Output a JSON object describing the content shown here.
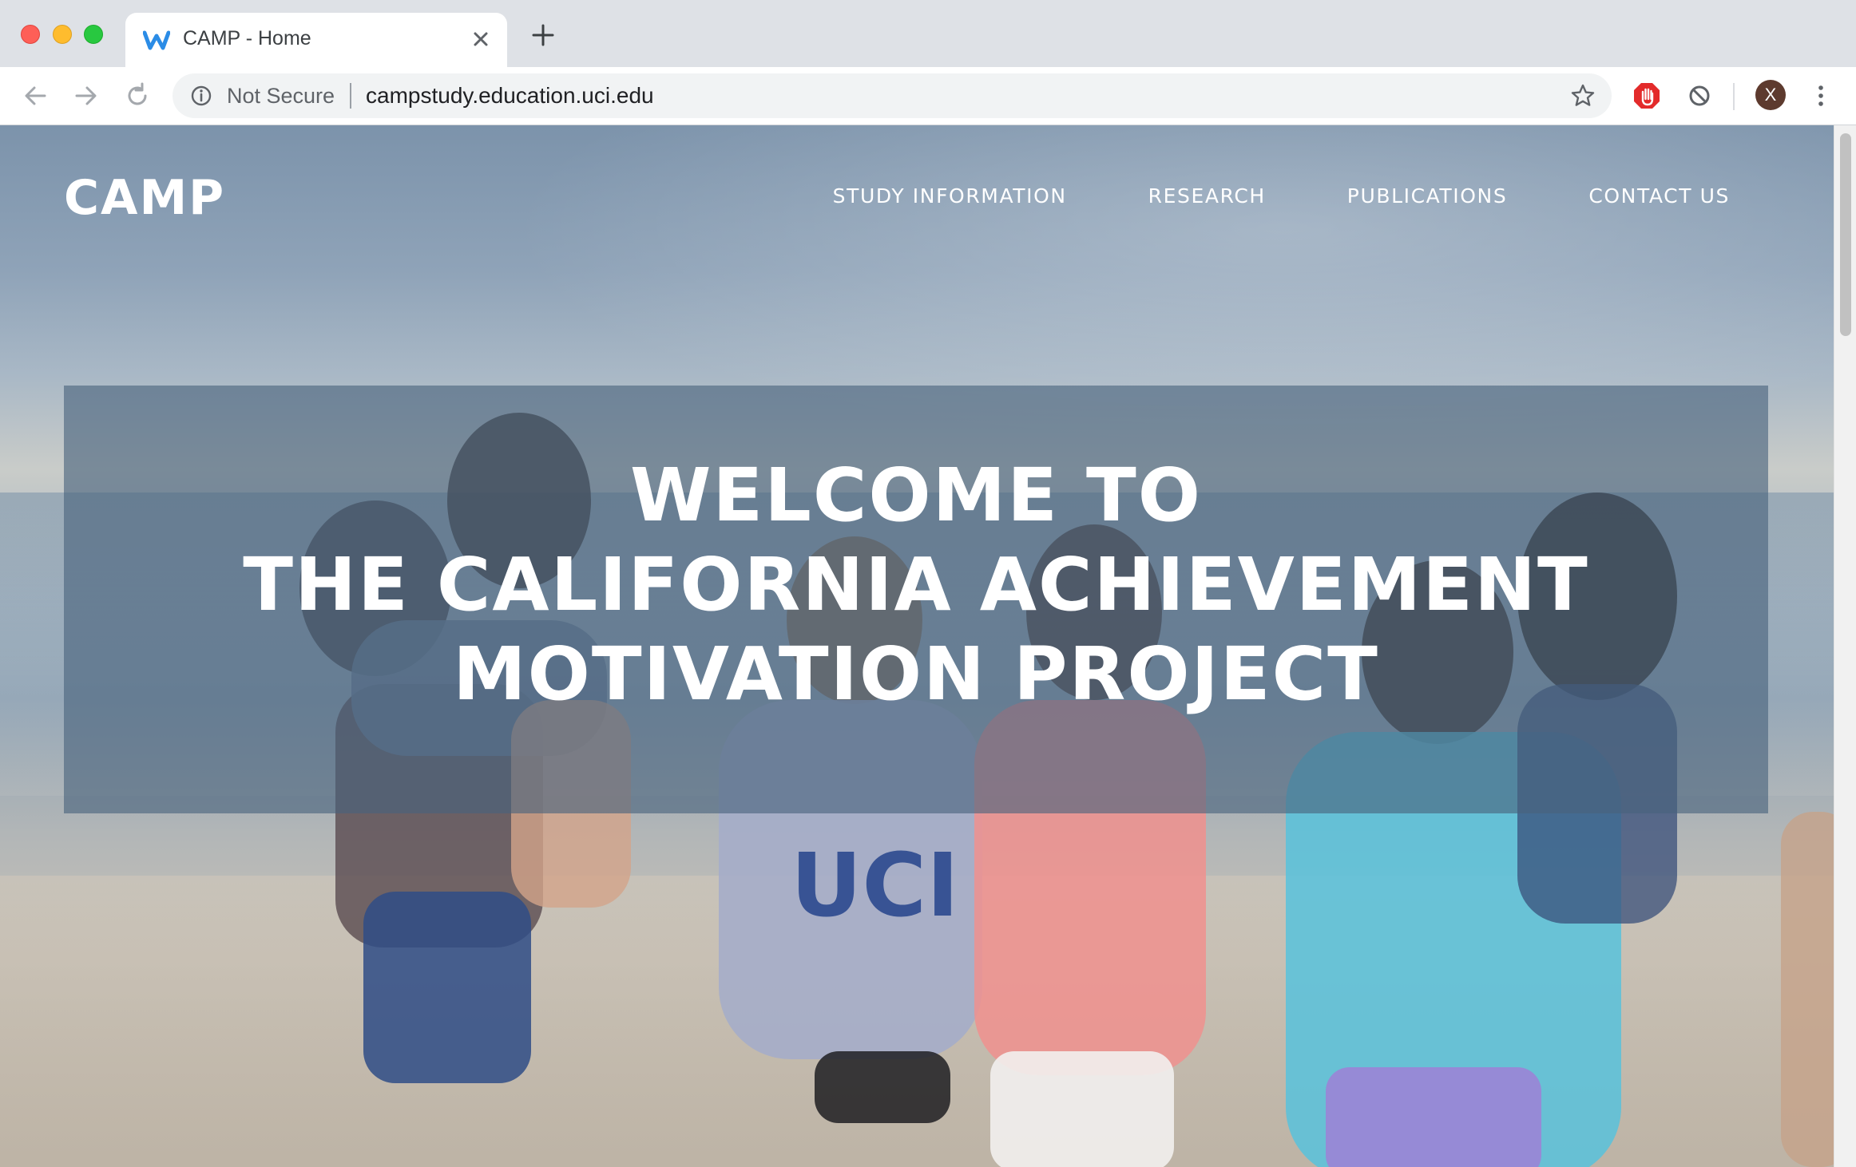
{
  "browser": {
    "tab": {
      "title": "CAMP - Home",
      "favicon": "weebly-w-icon"
    },
    "address_bar": {
      "security_label": "Not Secure",
      "url": "campstudy.education.uci.edu"
    },
    "profile_initial": "X",
    "colors": {
      "tab_strip": "#dee1e6",
      "omnibox": "#f1f3f4",
      "favicon_blue": "#2b8ce6",
      "stop_red": "#e32b2b",
      "avatar": "#5d3a2e"
    }
  },
  "site": {
    "logo": "CAMP",
    "nav": [
      {
        "label": "STUDY INFORMATION"
      },
      {
        "label": "RESEARCH"
      },
      {
        "label": "PUBLICATIONS"
      },
      {
        "label": "CONTACT US"
      }
    ],
    "hero": {
      "lines": [
        "WELCOME TO",
        "THE CALIFORNIA ACHIEVEMENT",
        "MOTIVATION PROJECT"
      ],
      "overlay_color": "#48627c"
    }
  }
}
